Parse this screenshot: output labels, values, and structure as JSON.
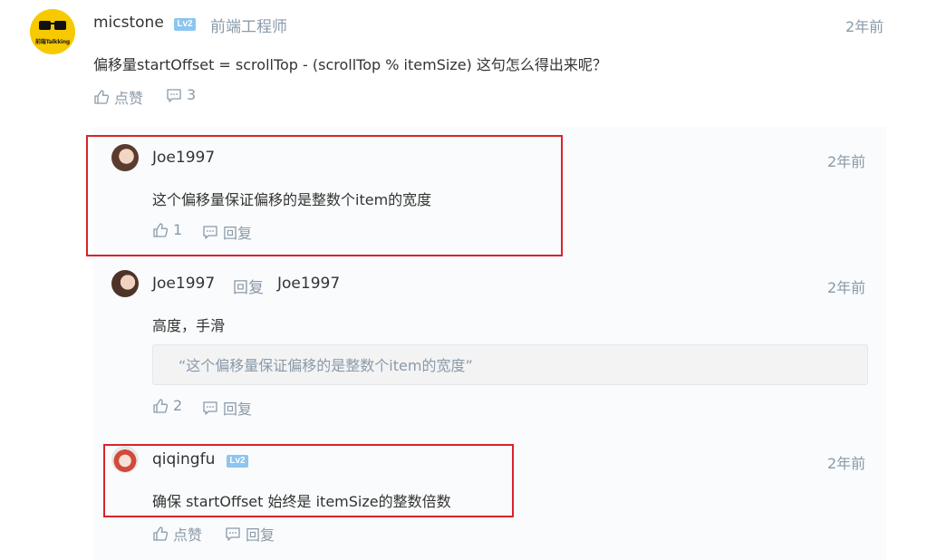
{
  "main_comment": {
    "author": "micstone",
    "level": "Lv2",
    "job": "前端工程师",
    "time": "2年前",
    "avatar_text": "前端Talkking",
    "content": "偏移量startOffset = scrollTop - (scrollTop % itemSize) 这句怎么得出来呢？",
    "like_label": "点赞",
    "reply_count": "3"
  },
  "replies": [
    {
      "author": "Joe1997",
      "time": "2年前",
      "content": "这个偏移量保证偏移的是整数个item的宽度",
      "like_count": "1",
      "reply_label": "回复"
    },
    {
      "author": "Joe1997",
      "reply_word": "回复",
      "reply_to": "Joe1997",
      "time": "2年前",
      "content": "高度，手滑",
      "quote": "“这个偏移量保证偏移的是整数个item的宽度”",
      "like_count": "2",
      "reply_label": "回复"
    },
    {
      "author": "qiqingfu",
      "level": "Lv2",
      "time": "2年前",
      "content": "确保 startOffset 始终是 itemSize的整数倍数",
      "like_label": "点赞",
      "reply_label": "回复"
    }
  ],
  "colors": {
    "highlight_border": "#d9232a",
    "level_badge": "#8cc5f0",
    "muted_text": "#8a9aa9",
    "reply_bg": "#fafbfc"
  }
}
